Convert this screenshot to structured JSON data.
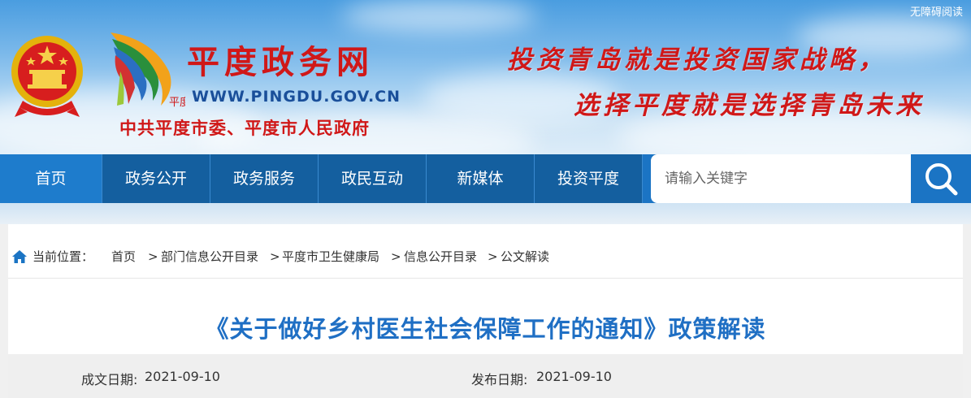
{
  "header": {
    "accessibility": "无障碍阅读",
    "site_title": "平度政务网",
    "site_url": "WWW.PINGDU.GOV.CN",
    "site_org": "中共平度市委、平度市人民政府",
    "slogan_line1": "投资青岛就是投资国家战略，",
    "slogan_line2": "选择平度就是选择青岛未来",
    "logo_char": "平度"
  },
  "nav": {
    "items": [
      "首页",
      "政务公开",
      "政务服务",
      "政民互动",
      "新媒体",
      "投资平度"
    ],
    "search_placeholder": "请输入关键字"
  },
  "breadcrumb": {
    "label": "当前位置：",
    "items": [
      "首页",
      "部门信息公开目录",
      "平度市卫生健康局",
      "信息公开目录",
      "公文解读"
    ],
    "separator": ">"
  },
  "article": {
    "title": "《关于做好乡村医生社会保障工作的通知》政策解读",
    "created_label": "成文日期:",
    "created_date": "2021-09-10",
    "published_label": "发布日期:",
    "published_date": "2021-09-10"
  },
  "colors": {
    "nav_blue": "#1b74c4",
    "title_blue": "#1f6fc4",
    "brand_red": "#d01818"
  }
}
